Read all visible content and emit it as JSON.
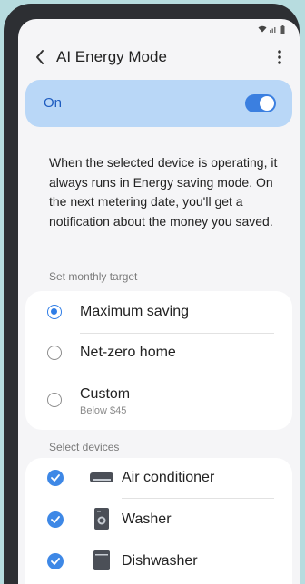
{
  "header": {
    "title": "AI Energy Mode"
  },
  "toggle": {
    "label": "On",
    "enabled": true,
    "accent": "#3b7fe0"
  },
  "description": "When the selected device is operating, it always runs in Energy saving mode. On the next metering date, you'll get a notification about the money you saved.",
  "monthly_target": {
    "section_label": "Set monthly target",
    "options": [
      {
        "label": "Maximum saving",
        "sublabel": "",
        "selected": true
      },
      {
        "label": "Net-zero home",
        "sublabel": "",
        "selected": false
      },
      {
        "label": "Custom",
        "sublabel": "Below $45",
        "selected": false
      }
    ]
  },
  "devices": {
    "section_label": "Select devices",
    "items": [
      {
        "label": "Air conditioner",
        "icon": "air-conditioner-icon",
        "checked": true
      },
      {
        "label": "Washer",
        "icon": "washer-icon",
        "checked": true
      },
      {
        "label": "Dishwasher",
        "icon": "dishwasher-icon",
        "checked": true
      }
    ]
  }
}
